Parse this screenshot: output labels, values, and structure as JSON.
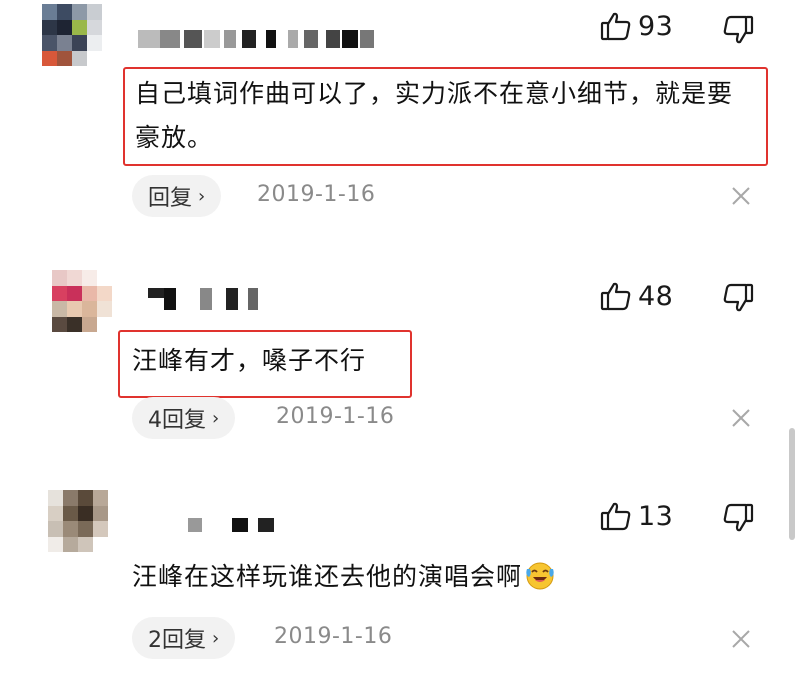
{
  "comments": [
    {
      "like_count": "93",
      "text": "自己填词作曲可以了，实力派不在意小细节，就是要豪放。",
      "reply_label": "回复",
      "date": "2019-1-16"
    },
    {
      "like_count": "48",
      "text": "汪峰有才，嗓子不行",
      "reply_label": "4回复",
      "date": "2019-1-16"
    },
    {
      "like_count": "13",
      "text": "汪峰在这样玩谁还去他的演唱会啊",
      "emoji": "laughing-crying-emoji",
      "reply_label": "2回复",
      "date": "2019-1-16"
    }
  ],
  "icons": {
    "like": "thumbs-up-icon",
    "dislike": "thumbs-down-icon",
    "close": "close-icon",
    "chevron": "chevron-right-icon"
  },
  "colors": {
    "highlight_border": "#e0332e",
    "reply_bg": "#f2f2f2",
    "date_text": "#8a8a8a"
  }
}
